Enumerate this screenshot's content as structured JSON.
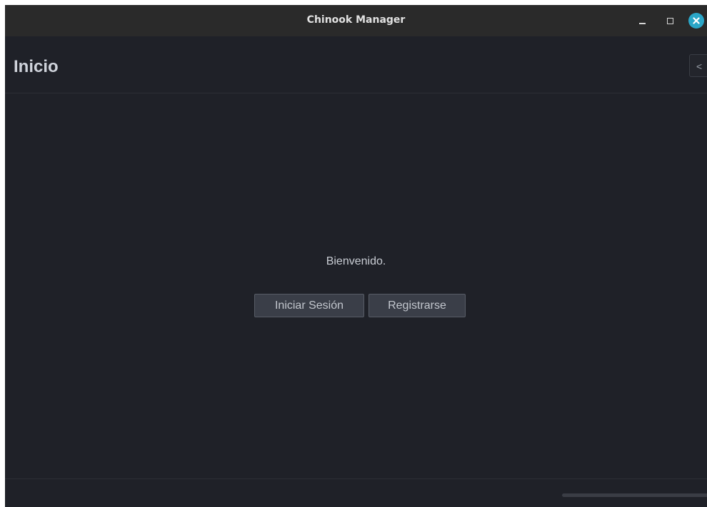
{
  "window": {
    "title": "Chinook Manager",
    "close_color": "#2aa6c7"
  },
  "header": {
    "title": "Inicio",
    "collapse_label": "<"
  },
  "main": {
    "welcome_text": "Bienvenido.",
    "login_label": "Iniciar Sesión",
    "register_label": "Registrarse"
  },
  "colors": {
    "background": "#1f2128",
    "titlebar": "#2a2a2a",
    "button_bg": "#3a3e48"
  }
}
